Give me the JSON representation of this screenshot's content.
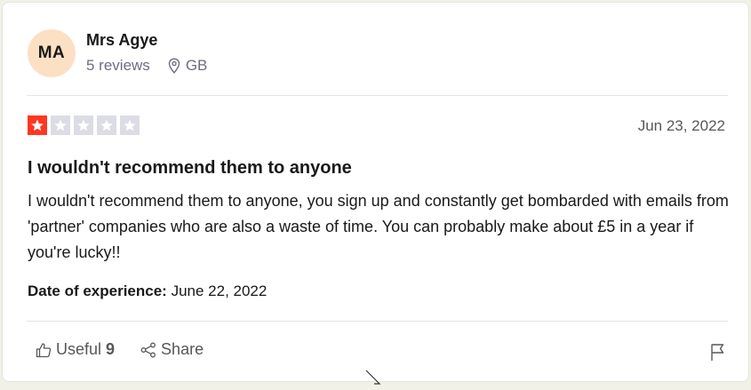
{
  "user": {
    "initials": "MA",
    "name": "Mrs Agye",
    "reviews": "5 reviews",
    "country": "GB"
  },
  "review": {
    "rating": 1,
    "max_rating": 5,
    "date": "Jun 23, 2022",
    "title": "I wouldn't recommend them to anyone",
    "body": "I wouldn't recommend them to anyone, you sign up and constantly get bombarded with emails from 'partner' companies who are also a waste of time. You can probably make about £5 in a year if you're lucky!!",
    "experience_label": "Date of experience:",
    "experience_date": " June 22, 2022"
  },
  "actions": {
    "useful_label": "Useful",
    "useful_count": "9",
    "share_label": "Share"
  },
  "colors": {
    "star_on": "#ff3722",
    "star_off": "#dcdce6",
    "avatar_bg": "#fce0c4"
  },
  "icons": [
    "location-pin-icon",
    "star-icon",
    "thumbs-up-icon",
    "share-icon",
    "flag-icon",
    "cursor-icon"
  ]
}
